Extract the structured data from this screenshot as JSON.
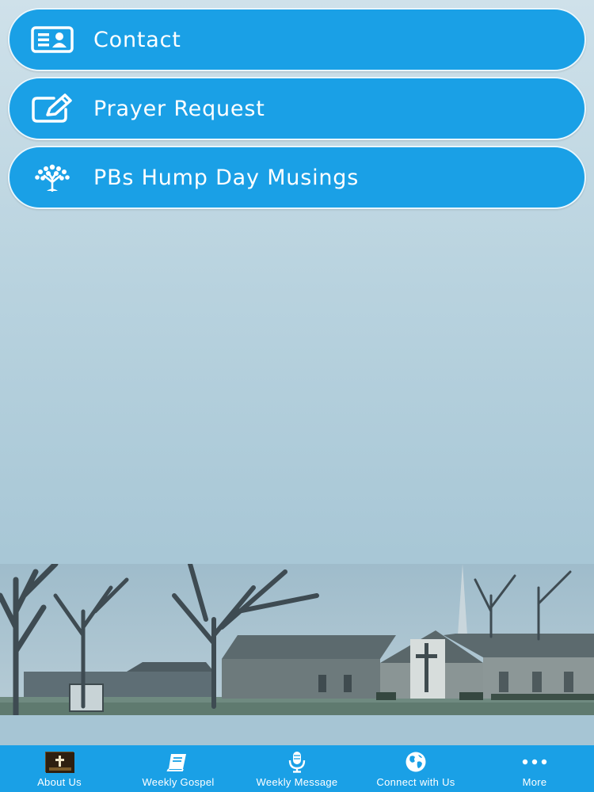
{
  "menu": {
    "items": [
      {
        "label": "Contact",
        "icon": "contact-card-icon"
      },
      {
        "label": "Prayer Request",
        "icon": "edit-pencil-icon"
      },
      {
        "label": "PBs Hump Day Musings",
        "icon": "tree-icon"
      }
    ]
  },
  "tabs": [
    {
      "label": "About Us",
      "icon": "church-thumbnail-icon"
    },
    {
      "label": "Weekly Gospel",
      "icon": "book-icon"
    },
    {
      "label": "Weekly Message",
      "icon": "microphone-icon"
    },
    {
      "label": "Connect with Us",
      "icon": "globe-icon"
    },
    {
      "label": "More",
      "icon": "more-dots-icon"
    }
  ],
  "colors": {
    "accent": "#1aa0e6",
    "background": "#b9d3df",
    "text_on_accent": "#ffffff"
  }
}
